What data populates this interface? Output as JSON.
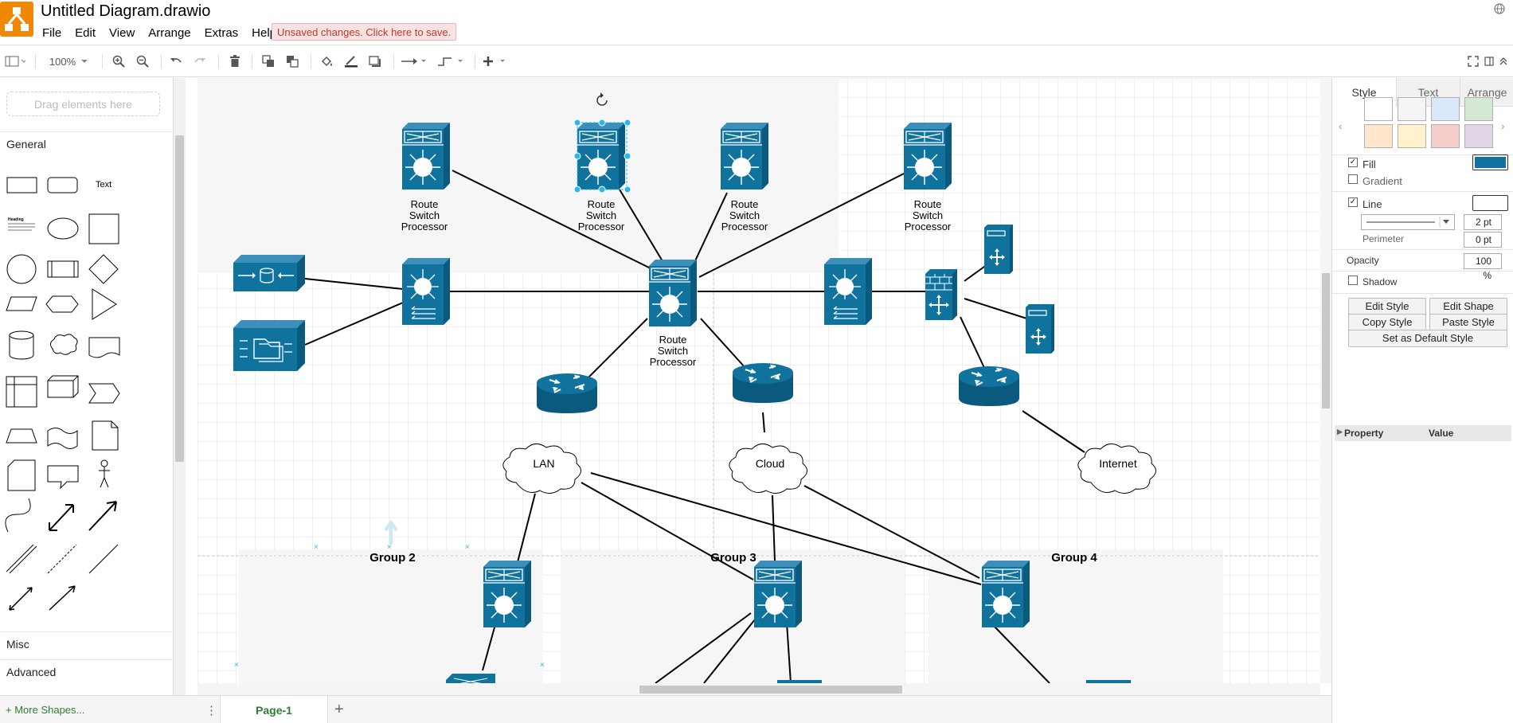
{
  "header": {
    "title": "Untitled Diagram.drawio",
    "menus": [
      "File",
      "Edit",
      "View",
      "Arrange",
      "Extras",
      "Help"
    ],
    "unsaved_notice": "Unsaved changes. Click here to save."
  },
  "toolbar": {
    "zoom": "100%"
  },
  "sidebar": {
    "drag_hint": "Drag elements here",
    "sections": [
      "General",
      "Misc",
      "Advanced"
    ],
    "text_shape_label": "Text",
    "heading_shape_label": "Heading",
    "more_shapes": "More Shapes..."
  },
  "canvas": {
    "node_label": "Route\nSwitch\nProcessor",
    "clouds": [
      "LAN",
      "Cloud",
      "Internet"
    ],
    "groups": [
      "Group 2",
      "Group 3",
      "Group 4"
    ]
  },
  "pages": {
    "tabs": [
      "Page-1"
    ]
  },
  "format_panel": {
    "tabs": [
      "Style",
      "Text",
      "Arrange"
    ],
    "swatches": [
      "#ffffff",
      "#f5f5f5",
      "#dae8fc",
      "#d5e8d4",
      "#ffe6cc",
      "#fff2cc",
      "#f8cecc",
      "#e1d5e7"
    ],
    "fill_label": "Fill",
    "fill_color": "#10739e",
    "gradient_label": "Gradient",
    "line_label": "Line",
    "line_width": "2 pt",
    "perimeter_label": "Perimeter",
    "perimeter_value": "0 pt",
    "opacity_label": "Opacity",
    "opacity_value": "100 %",
    "shadow_label": "Shadow",
    "buttons": {
      "edit_style": "Edit Style",
      "edit_shape": "Edit Shape",
      "copy_style": "Copy Style",
      "paste_style": "Paste Style",
      "set_default": "Set as Default Style"
    },
    "property_header": "Property",
    "value_header": "Value"
  },
  "colors": {
    "accent": "#10739e",
    "logo": "#f08705",
    "selection": "#29b6f2"
  }
}
